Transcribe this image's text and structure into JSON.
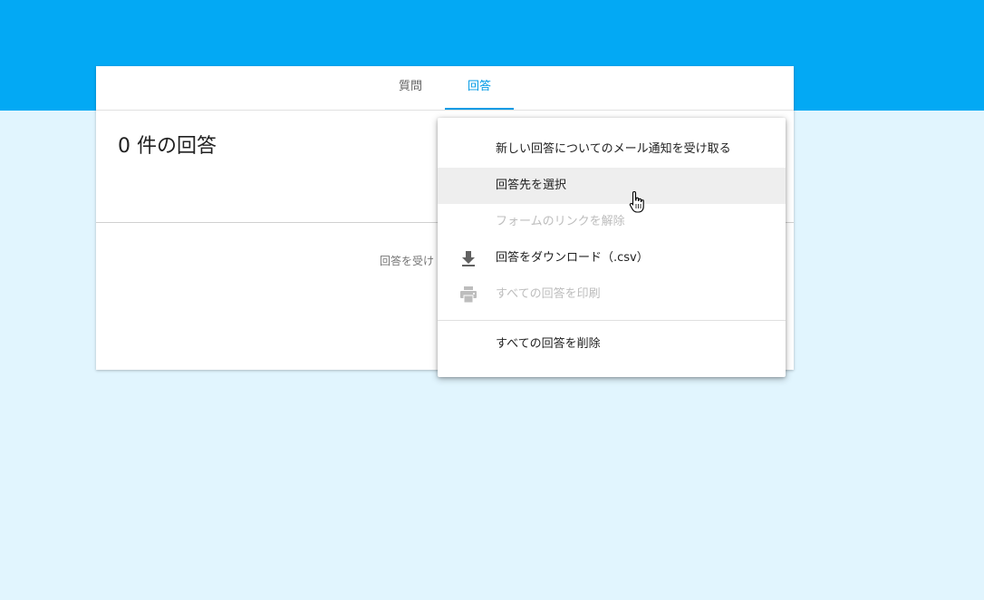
{
  "tabs": {
    "questions_label": "質問",
    "responses_label": "回答"
  },
  "responses": {
    "count_title": "0 件の回答",
    "accepting_text_partial": "回答を受け"
  },
  "menu": {
    "items": [
      {
        "label": "新しい回答についてのメール通知を受け取る",
        "icon": "",
        "disabled": false
      },
      {
        "label": "回答先を選択",
        "icon": "",
        "disabled": false,
        "hovered": true
      },
      {
        "label": "フォームのリンクを解除",
        "icon": "",
        "disabled": true
      },
      {
        "label": "回答をダウンロード（.csv）",
        "icon": "download-icon",
        "disabled": false
      },
      {
        "label": "すべての回答を印刷",
        "icon": "print-icon",
        "disabled": true
      },
      {
        "label": "すべての回答を削除",
        "icon": "",
        "disabled": false
      }
    ]
  },
  "colors": {
    "header": "#03a9f4",
    "background": "#e1f5fe",
    "accent": "#039be5",
    "menu_hover": "#eeeeee",
    "disabled_text": "#bdbdbd"
  }
}
